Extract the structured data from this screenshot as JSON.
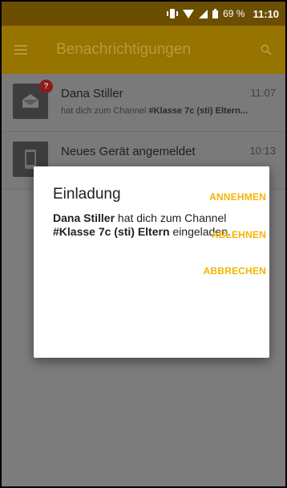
{
  "status_bar": {
    "battery": "69 %",
    "time": "11:10"
  },
  "app_bar": {
    "title": "Benachrichtigungen",
    "menu_icon": "hamburger-menu-icon",
    "search_icon": "search-icon"
  },
  "notifications": [
    {
      "title": "Dana Stiller",
      "time": "11:07",
      "subtitle_prefix": "hat dich zum Channel ",
      "subtitle_bold": "#Klasse 7c (sti) Eltern...",
      "badge": "?",
      "icon": "envelope-icon"
    },
    {
      "title": "Neues Gerät angemeldet",
      "time": "10:13",
      "icon": "phone-device-icon"
    }
  ],
  "dialog": {
    "title": "Einladung",
    "sender": "Dana Stiller",
    "text_1": " hat dich zum Channel ",
    "channel": "#Klasse 7c (sti) Eltern",
    "text_2": " eingeladen.",
    "accept_label": "ANNEHMEN",
    "decline_label": "ABLEHNEN",
    "cancel_label": "ABBRECHEN"
  },
  "colors": {
    "accent": "#f1b600",
    "app_bar_dimmed": "#977300",
    "status_bar_dimmed": "#6b4e00"
  }
}
